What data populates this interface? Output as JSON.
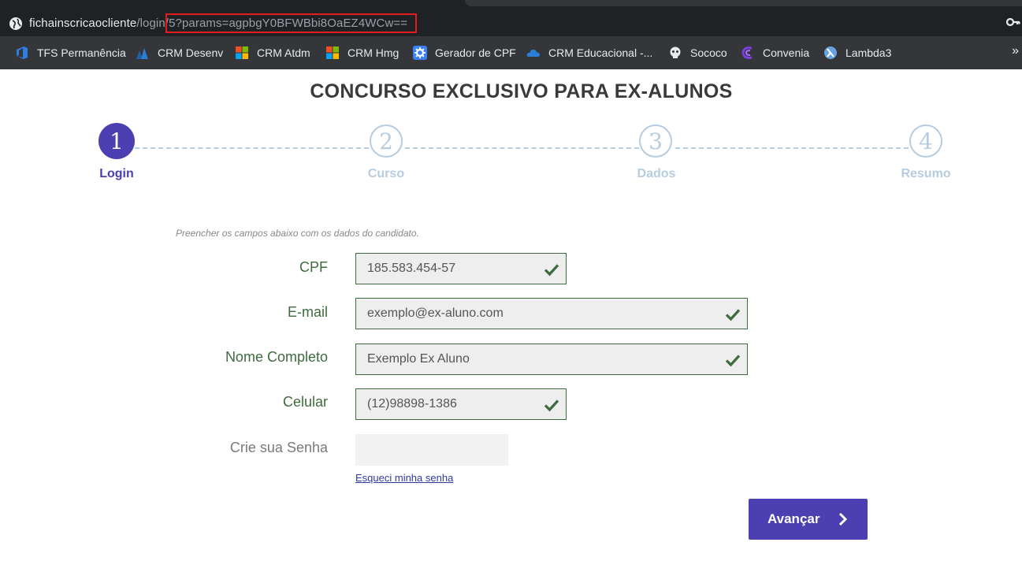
{
  "browser": {
    "url_host": "fichainscricaocliente",
    "url_path": "/login/",
    "url_highlighted": "5?params=agpbgY0BFWBbi8OaEZ4WCw==",
    "bookmarks": [
      {
        "label": "TFS Permanência",
        "icon": "azure-devops-icon",
        "color": "#2f7de1"
      },
      {
        "label": "CRM Desenv",
        "icon": "dynamics-icon",
        "color": "#1f5fae"
      },
      {
        "label": "CRM Atdm",
        "icon": "microsoft-icon"
      },
      {
        "label": "CRM Hmg",
        "icon": "microsoft-icon"
      },
      {
        "label": "Gerador de CPF",
        "icon": "gear-icon",
        "color": "#3b82f6"
      },
      {
        "label": "CRM Educacional -...",
        "icon": "cloud-icon",
        "color": "#2b7fd8"
      },
      {
        "label": "Sococo",
        "icon": "sococo-icon"
      },
      {
        "label": "Convenia",
        "icon": "convenia-icon",
        "color": "#7b3fe0"
      },
      {
        "label": "Lambda3",
        "icon": "lambda3-icon",
        "color": "#6aa2e0"
      }
    ],
    "more_label": "»"
  },
  "page": {
    "title": "CONCURSO EXCLUSIVO PARA EX-ALUNOS",
    "steps": [
      {
        "number": "1",
        "label": "Login",
        "active": true
      },
      {
        "number": "2",
        "label": "Curso",
        "active": false
      },
      {
        "number": "3",
        "label": "Dados",
        "active": false
      },
      {
        "number": "4",
        "label": "Resumo",
        "active": false
      }
    ],
    "hint": "Preencher os campos abaixo com os dados do candidato.",
    "fields": {
      "cpf": {
        "label": "CPF",
        "value": "185.583.454-57",
        "valid": true
      },
      "email": {
        "label": "E-mail",
        "value": "exemplo@ex-aluno.com",
        "valid": true
      },
      "nome": {
        "label": "Nome Completo",
        "value": "Exemplo Ex Aluno",
        "valid": true
      },
      "celular": {
        "label": "Celular",
        "value": "(12)98898-1386",
        "valid": true
      },
      "senha": {
        "label": "Crie sua Senha",
        "value": ""
      }
    },
    "forgot_link": "Esqueci minha senha",
    "next_button": "Avançar"
  },
  "colors": {
    "primary": "#4b3fb1",
    "valid_green": "#3e6b3e",
    "step_inactive": "#b6cce0"
  }
}
